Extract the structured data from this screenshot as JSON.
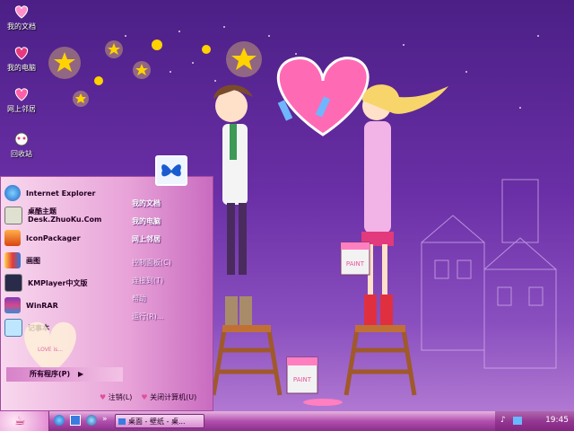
{
  "desktop": {
    "icons": [
      {
        "label": "我的文档",
        "icon": "my-documents-icon"
      },
      {
        "label": "我的电脑",
        "icon": "my-computer-icon"
      },
      {
        "label": "网上邻居",
        "icon": "network-icon"
      },
      {
        "label": "回收站",
        "icon": "recycle-bin-icon"
      }
    ],
    "wallpaper": {
      "paint_can_left": "PAINT",
      "paint_can_right": "PAINT",
      "love_text": "LOVE is..."
    }
  },
  "start_menu": {
    "pinned": [
      {
        "label": "Internet Explorer",
        "icon": "internet-explorer-icon"
      },
      {
        "label": "桌酷主题\nDesk.ZhuoKu.Com",
        "icon": "theme-icon"
      },
      {
        "label": "IconPackager",
        "icon": "iconpackager-icon"
      },
      {
        "label": "画图",
        "icon": "paint-icon"
      },
      {
        "label": "KMPlayer中文版",
        "icon": "kmplayer-icon"
      },
      {
        "label": "WinRAR",
        "icon": "winrar-icon"
      },
      {
        "label": "记事本",
        "icon": "notepad-icon"
      }
    ],
    "right": [
      {
        "label": "我的文档",
        "dim": false
      },
      {
        "label": "我的电脑",
        "dim": false
      },
      {
        "label": "网上邻居",
        "dim": false
      },
      {
        "label": "控制面板(C)",
        "dim": true
      },
      {
        "label": "连接到(T)",
        "dim": true
      },
      {
        "label": "帮助",
        "dim": true
      },
      {
        "label": "运行(R)...",
        "dim": true
      }
    ],
    "all_programs": "所有程序(P)",
    "logoff": "注销(L)",
    "shutdown": "关闭计算机(U)"
  },
  "taskbar": {
    "task_label": "桌面 - 壁纸 - 桌...",
    "clock": "19:45"
  },
  "colors": {
    "accent": "#b24fae",
    "wallpaper_top": "#4b1f86",
    "heart": "#ff5fa8"
  }
}
